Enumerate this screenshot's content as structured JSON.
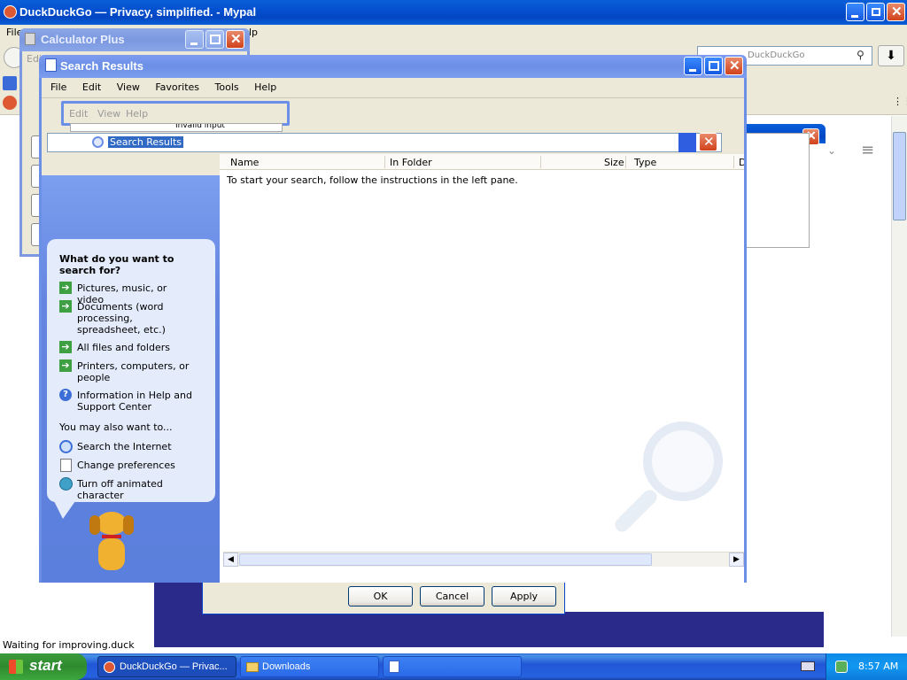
{
  "browser": {
    "title": "DuckDuckGo — Privacy, simplified. - Mypal",
    "menu_peek": "File",
    "menu_peek2": "lp",
    "search_placeholder": "DuckDuckGo",
    "status": "Waiting for improving.duck"
  },
  "calculator": {
    "title": "Calculator Plus",
    "menu": [
      "Edit",
      "View",
      "Help"
    ],
    "peek_e": "Edi",
    "peek_text": "Invalid input"
  },
  "search_window": {
    "title": "Search Results",
    "menu": [
      "File",
      "Edit",
      "View",
      "Favorites",
      "Tools",
      "Help"
    ],
    "address_value": "Search Results",
    "columns": [
      "Name",
      "In Folder",
      "Size",
      "Type",
      "D"
    ],
    "empty_message": "To start your search, follow the instructions in the left pane."
  },
  "assistant": {
    "heading": "What do you want to search for?",
    "options": [
      {
        "label": "Pictures, music, or video",
        "icon": "arrow-right-icon"
      },
      {
        "label": "Documents (word processing, spreadsheet, etc.)",
        "icon": "arrow-right-icon"
      },
      {
        "label": "All files and folders",
        "icon": "arrow-right-icon"
      },
      {
        "label": "Printers, computers, or people",
        "icon": "arrow-right-icon"
      },
      {
        "label": "Information in Help and Support Center",
        "icon": "help-icon"
      }
    ],
    "also_heading": "You may also want to...",
    "also": [
      {
        "label": "Search the Internet",
        "icon": "search-internet-icon"
      },
      {
        "label": "Change preferences",
        "icon": "preferences-icon"
      },
      {
        "label": "Turn off animated character",
        "icon": "character-icon"
      }
    ]
  },
  "dialog_buttons": {
    "ok": "OK",
    "cancel": "Cancel",
    "apply": "Apply"
  },
  "taskbar": {
    "start": "start",
    "tasks": [
      "DuckDuckGo — Privac...",
      "Downloads"
    ],
    "clock": "8:57 AM"
  },
  "colors": {
    "xp_blue": "#0a5fd8",
    "pane_blue": "#6b8fe0",
    "close_red": "#d0421c"
  }
}
